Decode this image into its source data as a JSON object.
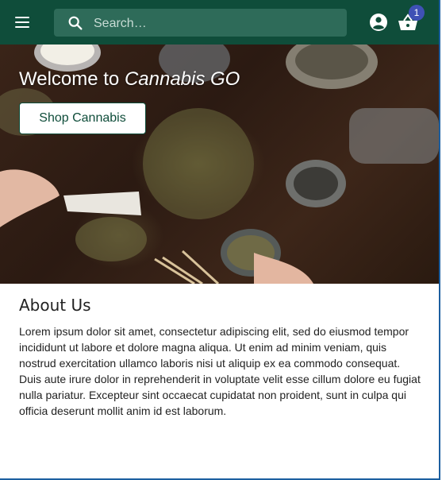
{
  "header": {
    "menu_icon": "menu-icon",
    "search": {
      "placeholder": "Search…",
      "icon": "search-icon"
    },
    "account_icon": "account-circle-icon",
    "cart": {
      "icon": "shopping-basket-icon",
      "badge_count": "1"
    },
    "colors": {
      "bar": "#0f4d3a",
      "search_bg": "#2e6b59",
      "badge": "#3f51b5"
    }
  },
  "hero": {
    "title_prefix": "Welcome to ",
    "title_brand": "Cannabis GO",
    "button_label": "Shop Cannabis",
    "image": "cannabis-tabletop-photo"
  },
  "about": {
    "heading": "About Us",
    "body": "Lorem ipsum dolor sit amet, consectetur adipiscing elit, sed do eiusmod tempor incididunt ut labore et dolore magna aliqua. Ut enim ad minim veniam, quis nostrud exercitation ullamco laboris nisi ut aliquip ex ea commodo consequat. Duis aute irure dolor in reprehenderit in voluptate velit esse cillum dolore eu fugiat nulla pariatur. Excepteur sint occaecat cupidatat non proident, sunt in culpa qui officia deserunt mollit anim id est laborum."
  }
}
